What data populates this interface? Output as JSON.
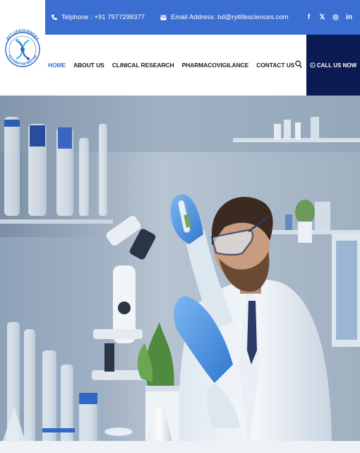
{
  "logo": {
    "brand_text": "RYT LIFESCIENCES",
    "tagline": "DO IT RIGHT THE FIRST TIME",
    "colors": {
      "ring": "#2f66c9",
      "accent": "#3bb6e8"
    }
  },
  "topbar": {
    "background": "#3a6fd1",
    "phone_label": "Telphone : +91 7977298377",
    "email_label": "Email Address: bd@rytlifesciences.com",
    "phone_icon": "phone-icon",
    "email_icon": "envelope-icon",
    "social": [
      {
        "name": "facebook-icon",
        "glyph": "f"
      },
      {
        "name": "x-twitter-icon",
        "glyph": "𝕏"
      },
      {
        "name": "instagram-icon",
        "glyph": "◎"
      },
      {
        "name": "linkedin-icon",
        "glyph": "in"
      }
    ]
  },
  "nav": {
    "items": [
      {
        "label": "HOME",
        "active": true
      },
      {
        "label": "ABOUT US",
        "active": false
      },
      {
        "label": "CLINICAL RESEARCH",
        "active": false
      },
      {
        "label": "PHARMACOVIGILANCE",
        "active": false
      },
      {
        "label": "CONTACT US",
        "active": false
      }
    ],
    "active_color": "#3a6fd1",
    "search_icon": "search-icon",
    "call_button": {
      "label": "CALL US NOW",
      "icon": "whatsapp-icon",
      "background": "#0d1b55"
    }
  },
  "hero": {
    "image_alt": "scientist-with-blue-gloves-in-laboratory",
    "tint": "#a9b9c9"
  }
}
